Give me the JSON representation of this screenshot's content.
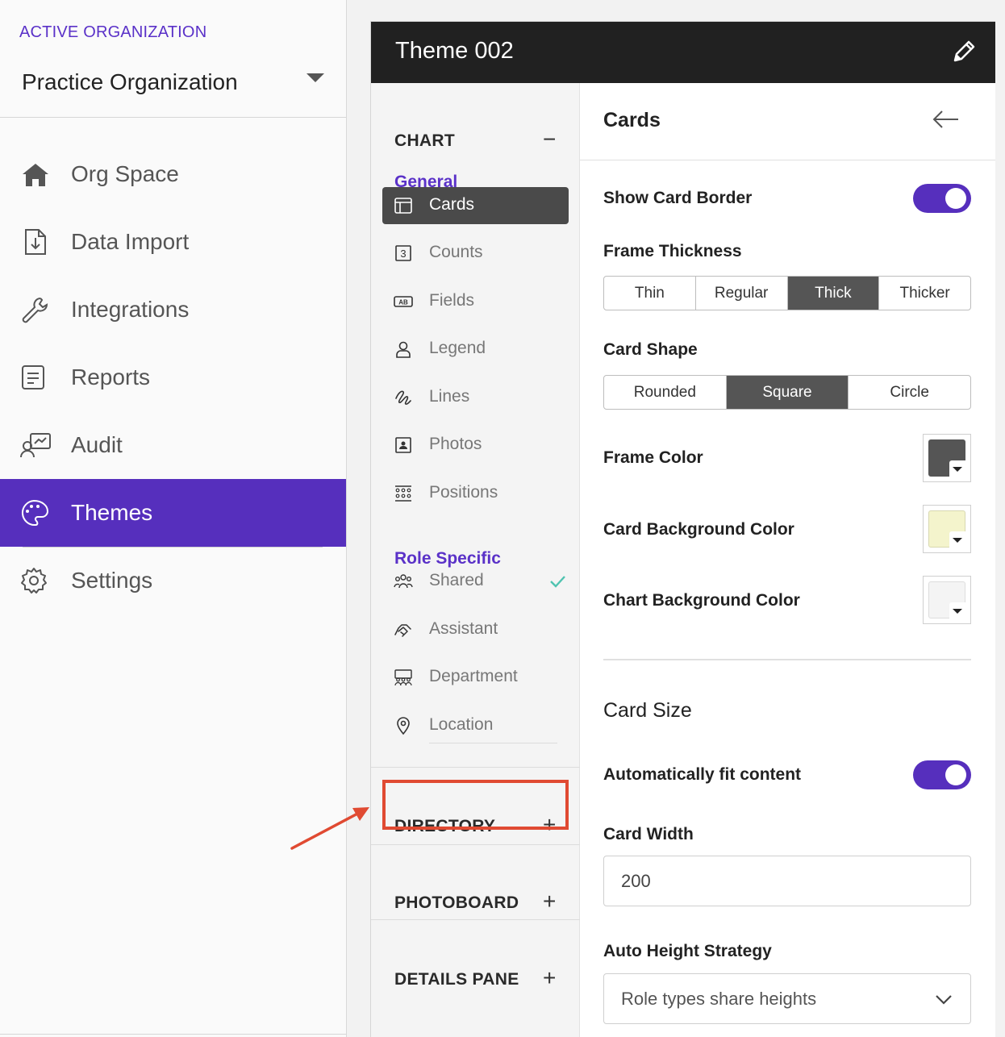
{
  "sidebar": {
    "org_label": "ACTIVE ORGANIZATION",
    "org_name": "Practice Organization",
    "items": [
      {
        "label": "Org Space",
        "icon": "home-icon"
      },
      {
        "label": "Data Import",
        "icon": "file-import-icon"
      },
      {
        "label": "Integrations",
        "icon": "wrench-icon"
      },
      {
        "label": "Reports",
        "icon": "report-icon"
      },
      {
        "label": "Audit",
        "icon": "audit-icon"
      },
      {
        "label": "Themes",
        "icon": "palette-icon",
        "active": true
      },
      {
        "label": "Settings",
        "icon": "gear-icon"
      }
    ]
  },
  "theme": {
    "title": "Theme 002"
  },
  "subnav": {
    "chart_label": "CHART",
    "chart_toggle": "−",
    "general_label": "General",
    "general_items": [
      "Cards",
      "Counts",
      "Fields",
      "Legend",
      "Lines",
      "Photos",
      "Positions"
    ],
    "role_label": "Role Specific",
    "role_items": [
      "Shared",
      "Assistant",
      "Department",
      "Location"
    ],
    "directory_label": "DIRECTORY",
    "photoboard_label": "PHOTOBOARD",
    "details_label": "DETAILS PANE",
    "expand_symbol": "+"
  },
  "content": {
    "title": "Cards",
    "show_border_label": "Show Card Border",
    "show_border_on": true,
    "frame_thickness_label": "Frame Thickness",
    "thickness_options": [
      "Thin",
      "Regular",
      "Thick",
      "Thicker"
    ],
    "thickness_selected": "Thick",
    "card_shape_label": "Card Shape",
    "shape_options": [
      "Rounded",
      "Square",
      "Circle"
    ],
    "shape_selected": "Square",
    "frame_color_label": "Frame Color",
    "frame_color": "#555555",
    "card_bg_label": "Card Background Color",
    "card_bg_color": "#f4f4cc",
    "chart_bg_label": "Chart Background Color",
    "chart_bg_color": "#f4f4f4",
    "card_size_label": "Card Size",
    "auto_fit_label": "Automatically fit content",
    "auto_fit_on": true,
    "card_width_label": "Card Width",
    "card_width_value": "200",
    "auto_height_label": "Auto Height Strategy",
    "auto_height_value": "Role types share heights"
  },
  "colors": {
    "accent": "#562fbd",
    "header_bg": "#212121",
    "highlight": "#e04a32",
    "check": "#4fc3b0"
  }
}
